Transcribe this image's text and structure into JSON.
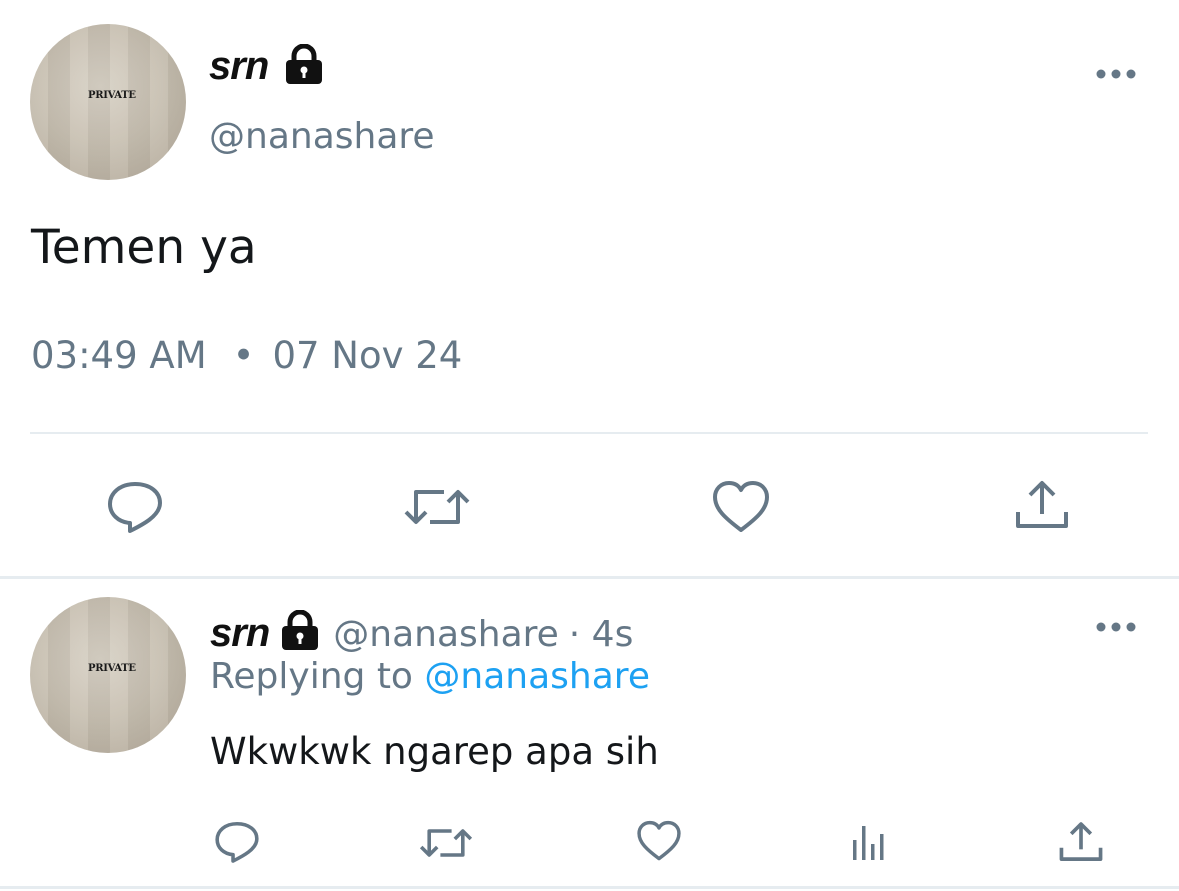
{
  "tweet": {
    "avatar_text": "PRIVATE",
    "display_name": "srn",
    "handle": "@nanashare",
    "text": "Temen ya",
    "time": "03:49 AM",
    "separator": "•",
    "date": "07 Nov 24"
  },
  "reply": {
    "avatar_text": "PRIVATE",
    "display_name": "srn",
    "handle": "@nanashare",
    "age": "· 4s",
    "replying_prefix": "Replying to",
    "replying_to": "@nanashare",
    "text": "Wkwkwk ngarep apa sih"
  },
  "icons": {
    "lock": "lock-icon",
    "more": "more-dots-icon",
    "reply": "reply-icon",
    "retweet": "retweet-icon",
    "like": "heart-icon",
    "share": "share-icon",
    "analytics": "analytics-icon"
  },
  "colors": {
    "link": "#1da1f2",
    "muted": "#657786",
    "text": "#14171a",
    "divider": "#e6ecf0"
  }
}
